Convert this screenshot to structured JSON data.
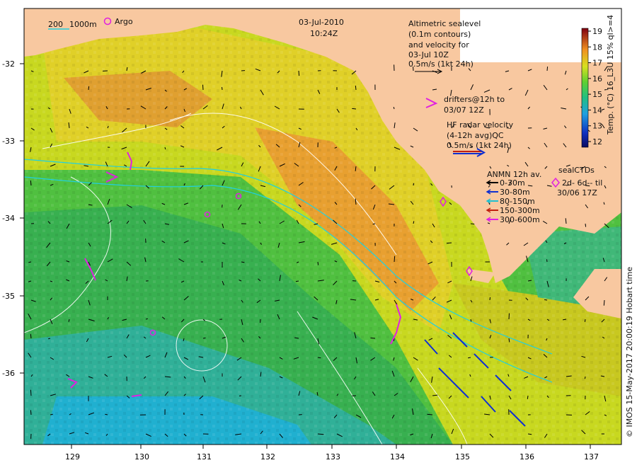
{
  "title": {
    "date": "03-Jul-2010",
    "time": "10:24Z"
  },
  "axes": {
    "x_ticks": [
      "129",
      "130",
      "131",
      "132",
      "133",
      "134",
      "135",
      "136",
      "137"
    ],
    "y_ticks": [
      "-32",
      "-33",
      "-34",
      "-35",
      "-36"
    ],
    "lon_range": [
      128.2,
      137.6
    ],
    "lat_range": [
      -36.9,
      -31.45
    ]
  },
  "legend_depth": {
    "line1": "200",
    "line2": "1000m",
    "argo_label": "Argo"
  },
  "altimetry": {
    "line1": "Altimetric sealevel",
    "line2": "(0.1m contours)",
    "line3": "and velocity for",
    "line4": "03-Jul 10Z",
    "scale": "0.5m/s (1kt 24h)"
  },
  "drifters": {
    "line1": "drifters@12h to",
    "line2": "03/07 12Z"
  },
  "hf_radar": {
    "line1": "HF radar velocity",
    "line2": "(4-12h avg)QC",
    "scale": "0.5m/s (1kt 24h)"
  },
  "anmn": {
    "title": "ANMN 12h av.",
    "items": [
      {
        "label": "0-30m",
        "color": "#000000"
      },
      {
        "label": "30-80m",
        "color": "#1030d0"
      },
      {
        "label": "80-150m",
        "color": "#20c0d0"
      },
      {
        "label": "150-300m",
        "color": "#c02010"
      },
      {
        "label": "300-600m",
        "color": "#e020e0"
      }
    ]
  },
  "sealctds": {
    "title": "sealCTDs",
    "line2": "2d- 6d-- til",
    "line3": "30/06 17Z"
  },
  "colorbar": {
    "ticks": [
      "12",
      "13",
      "14",
      "15",
      "16",
      "17",
      "18",
      "19"
    ],
    "label": "Temp. (°C) 16_L3U 15% ql>=4"
  },
  "credit": "© IMOS 15-May-2017 20:00:19 Hobart time",
  "colors": {
    "land": "#f8c8a0",
    "sst_warm": "#e8a030",
    "sst_mid": "#c8d820",
    "sst_cool": "#40c040",
    "sst_cold": "#20b0c0",
    "argo": "#e020e0"
  }
}
